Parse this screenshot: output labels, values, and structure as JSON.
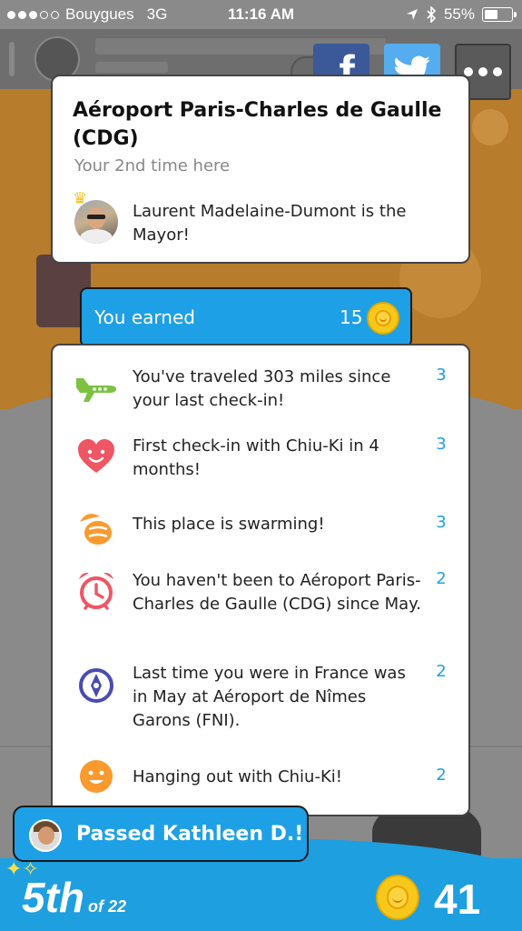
{
  "status_bar": {
    "carrier": "Bouygues",
    "network": "3G",
    "time": "11:16 AM",
    "battery": "55%",
    "battery_level": 0.55
  },
  "share": {
    "facebook_glyph": "f",
    "icons": [
      "facebook-icon",
      "twitter-icon",
      "more-icon"
    ]
  },
  "venue": {
    "title": "Aéroport Paris-Charles de Gaulle (CDG)",
    "visit_text": "Your 2nd time here",
    "mayor_text": "Laurent Madelaine-Dumont is the Mayor!"
  },
  "earned": {
    "label": "You earned",
    "total": "15",
    "items": [
      {
        "icon": "airplane-icon",
        "text": "You've traveled 303 miles since your last check-in!",
        "points": "3"
      },
      {
        "icon": "heart-icon",
        "text": "First check-in with Chiu-Ki in 4 months!",
        "points": "3"
      },
      {
        "icon": "swarm-icon",
        "text": "This place is swarming!",
        "points": "3"
      },
      {
        "icon": "alarm-clock-icon",
        "text": "You haven't been to Aéroport Paris-Charles de Gaulle (CDG) since May.",
        "points": "2"
      },
      {
        "icon": "compass-icon",
        "text": "Last time you were in France was in May at Aéroport de Nîmes Garons (FNI).",
        "points": "2"
      },
      {
        "icon": "smiley-icon",
        "text": "Hanging out with Chiu-Ki!",
        "points": "2"
      }
    ]
  },
  "passed": {
    "text": "Passed Kathleen D.!"
  },
  "leaderboard": {
    "rank": "5th",
    "of_total": "of 22",
    "coins": "41"
  },
  "colors": {
    "accent_blue": "#1ea0e6",
    "coin_gold": "#f7c81c",
    "facebook": "#3b5998",
    "twitter": "#55acee",
    "points_blue": "#1ea0e6"
  }
}
